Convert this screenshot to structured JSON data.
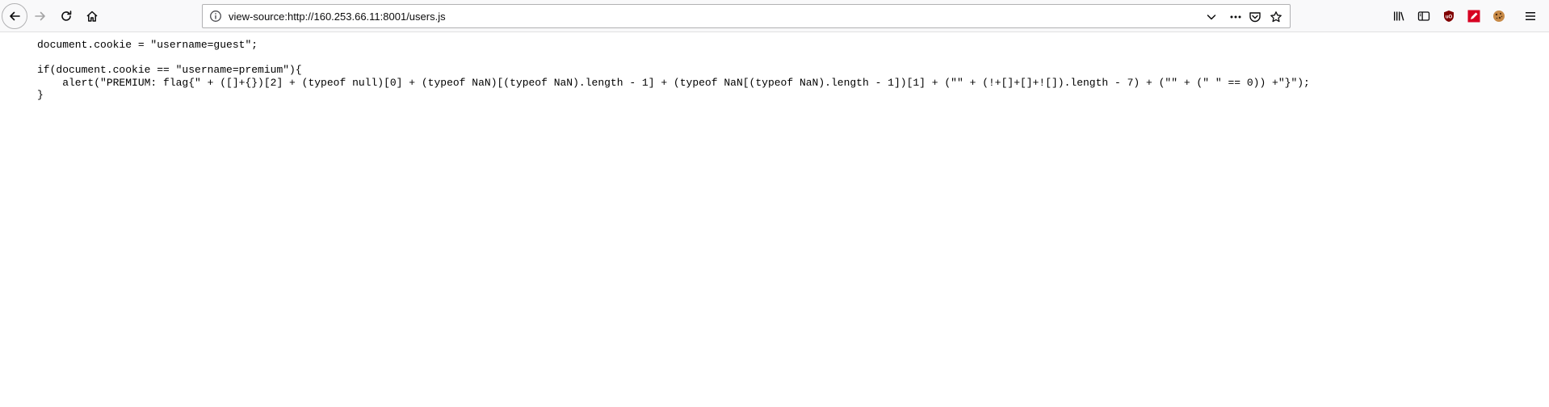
{
  "toolbar": {
    "back_icon": "back-arrow-icon",
    "forward_icon": "forward-arrow-icon",
    "reload_icon": "reload-icon",
    "home_icon": "home-icon"
  },
  "urlbar": {
    "url": "view-source:http://160.253.66.11:8001/users.js",
    "info_icon": "info-icon",
    "dropdown_icon": "chevron-down-icon",
    "more_icon": "more-dots-icon",
    "pocket_icon": "pocket-icon",
    "bookmark_icon": "star-icon"
  },
  "extensions": {
    "library_icon": "library-icon",
    "sidebar_icon": "sidebar-icon",
    "ublock_icon": "ublock-icon",
    "red_ext_icon": "edit-extension-icon",
    "cookie_icon": "cookie-icon",
    "menu_icon": "hamburger-menu-icon",
    "ublock_color": "#800000",
    "red_ext_color": "#d70022"
  },
  "source": {
    "lines": [
      "document.cookie = \"username=guest\";",
      "",
      "if(document.cookie == \"username=premium\"){",
      "    alert(\"PREMIUM: flag{\" + ([]+{})[2] + (typeof null)[0] + (typeof NaN)[(typeof NaN).length - 1] + (typeof NaN[(typeof NaN).length - 1])[1] + (\"\" + (!+[]+[]+![]).length - 7) + (\"\" + (\" \" == 0)) +\"}\");",
      "}"
    ]
  }
}
